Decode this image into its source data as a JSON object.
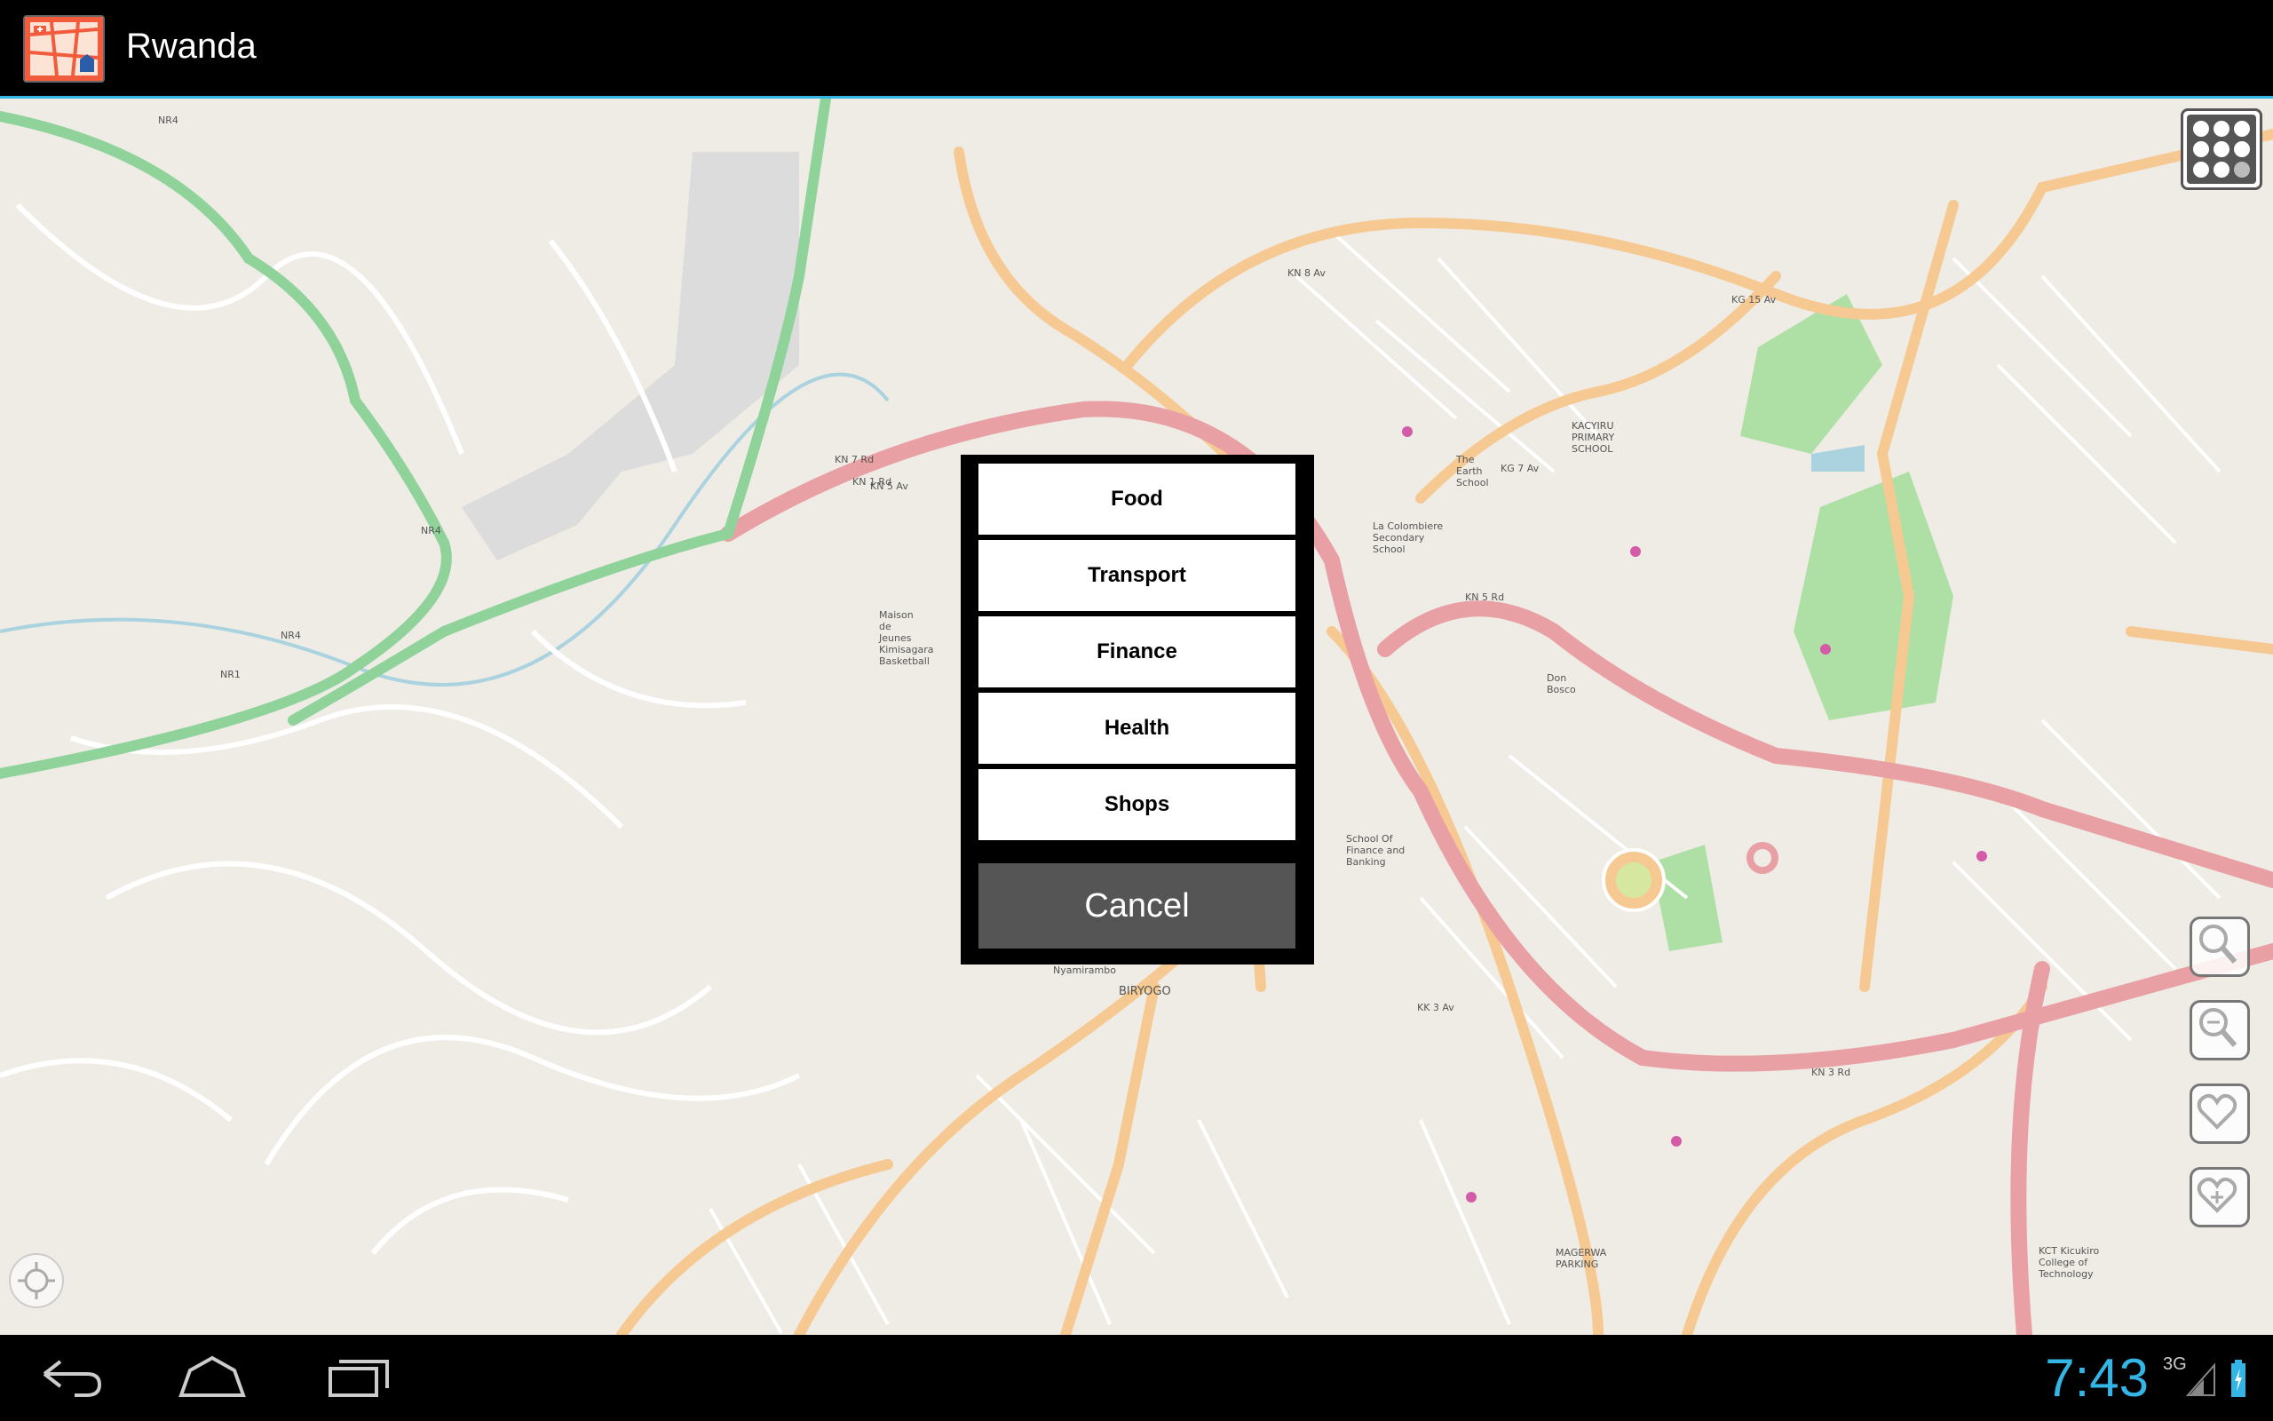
{
  "app": {
    "title": "Rwanda"
  },
  "dialog": {
    "categories": [
      {
        "label": "Food"
      },
      {
        "label": "Transport"
      },
      {
        "label": "Finance"
      },
      {
        "label": "Health"
      },
      {
        "label": "Shops"
      }
    ],
    "cancel_label": "Cancel"
  },
  "map": {
    "labels": {
      "nr4_top": "NR4",
      "nr4_mid": "NR4",
      "nr4_low": "NR4",
      "nr1": "NR1",
      "kn7rd": "KN 7 Rd",
      "kn1rd": "KN 1 Rd",
      "kn5av": "KN 5 Av",
      "kg15av": "KG 15 Av",
      "kn8av": "KN 8 Av",
      "kn5rd": "KN 5 Rd",
      "kn3rd": "KN 3 Rd",
      "kk3av": "KK 3 Av",
      "kg7av": "KG 7 Av",
      "kacyiru": "KACYIRU PRIMARY SCHOOL",
      "colombiere": "La Colombiere Secondary School",
      "nyamirambo": "Nyamirambo",
      "biryogo": "BIRYOGO",
      "sfb": "School Of Finance and Banking",
      "magerwa": "MAGERWA PARKING",
      "kct": "KCT Kicukiro College of Technology",
      "donbosco": "Don Bosco",
      "earth": "The Earth School",
      "maison": "Maison de Jeunes Kimisagara Basketball"
    }
  },
  "status": {
    "clock": "7:43",
    "network": "3G"
  },
  "colors": {
    "accent": "#33b5e5",
    "road": "#f6c992",
    "primary_road": "#e8a0a4",
    "trunk": "#8fd39a",
    "park": "#aee0a5"
  },
  "icons": {
    "app": "app-map-icon",
    "grid": "grid-menu-icon",
    "zoom_in": "zoom-in-icon",
    "zoom_out": "zoom-out-icon",
    "favorites": "heart-icon",
    "add_favorite": "heart-add-icon",
    "back": "back-icon",
    "home": "home-icon",
    "recents": "recents-icon",
    "locate": "locate-icon"
  }
}
